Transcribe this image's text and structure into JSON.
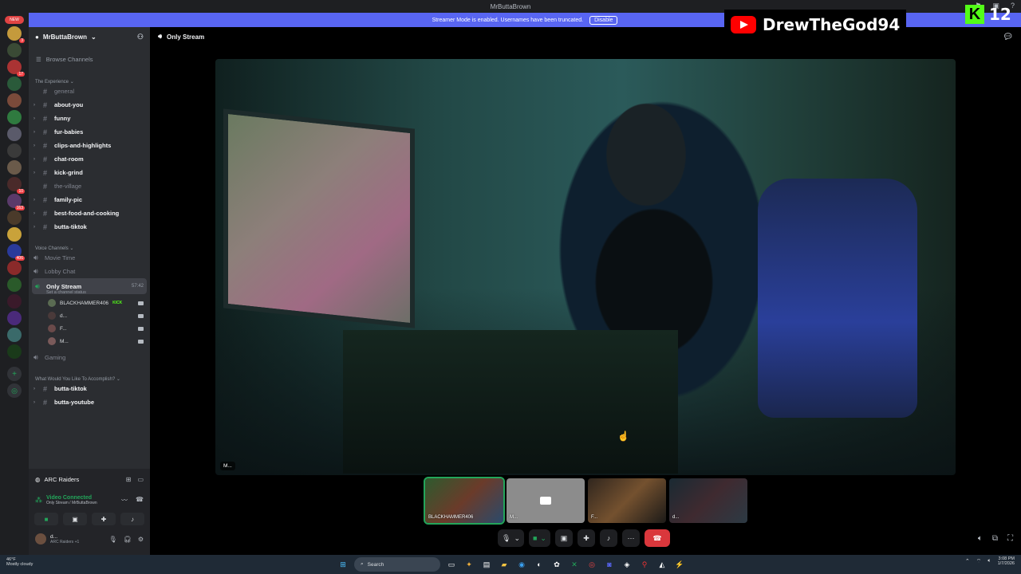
{
  "window": {
    "title": "MrButtaBrown"
  },
  "banner": {
    "text": "Streamer Mode is enabled. Usernames have been truncated.",
    "button": "Disable",
    "color": "#5865f2"
  },
  "overlays": {
    "youtube_name": "DrewTheGod94",
    "kick_count": "12",
    "kick_logo": "K"
  },
  "server_rail": {
    "new_label": "NEW",
    "badges": [
      "3",
      "17",
      "8",
      "163",
      "406",
      "10"
    ]
  },
  "sidebar": {
    "guild_name": "MrButtaBrown",
    "browse_channels": "Browse Channels",
    "categories": [
      {
        "name": "The Experience",
        "channels": [
          {
            "name": "general",
            "muted": true
          },
          {
            "name": "about-you",
            "muted": false
          },
          {
            "name": "funny",
            "muted": false
          },
          {
            "name": "fur-babies",
            "muted": false
          },
          {
            "name": "clips-and-highlights",
            "muted": false
          },
          {
            "name": "chat-room",
            "muted": false
          },
          {
            "name": "kick-grind",
            "muted": false
          },
          {
            "name": "the-village",
            "muted": true
          },
          {
            "name": "family-pic",
            "muted": false
          },
          {
            "name": "best-food-and-cooking",
            "muted": false
          },
          {
            "name": "butta-tiktok",
            "muted": false
          }
        ]
      },
      {
        "name": "Voice Channels",
        "channels": [
          {
            "name": "Movie Time"
          },
          {
            "name": "Lobby Chat"
          },
          {
            "name": "Only Stream",
            "timer": "57:42",
            "status": "Set a channel status"
          },
          {
            "name": "Gaming"
          }
        ]
      },
      {
        "name": "What Would You Like To Accomplish?",
        "channels": [
          {
            "name": "butta-tiktok"
          },
          {
            "name": "butta-youtube"
          }
        ]
      }
    ],
    "members": [
      {
        "name": "BLACKHAMMER406",
        "tag": "KICK"
      },
      {
        "name": "d..."
      },
      {
        "name": "F..."
      },
      {
        "name": "M..."
      }
    ]
  },
  "voice_panel": {
    "activity": "ARC Raiders",
    "status": "Video Connected",
    "location": "Only Stream / MrButtaBrown",
    "user_name": "d...",
    "user_activity": "ARC Raiders +1"
  },
  "main": {
    "channel_title": "Only Stream",
    "main_tile_label": "M...",
    "thumbnails": [
      {
        "label": "BLACKHAMMER406",
        "active": true
      },
      {
        "label": "M..."
      },
      {
        "label": "F..."
      },
      {
        "label": "d..."
      }
    ]
  },
  "taskbar": {
    "temperature": "46°F",
    "weather": "Mostly cloudy",
    "search": "Search",
    "time": "3:08 PM",
    "date": "1/7/2026"
  }
}
